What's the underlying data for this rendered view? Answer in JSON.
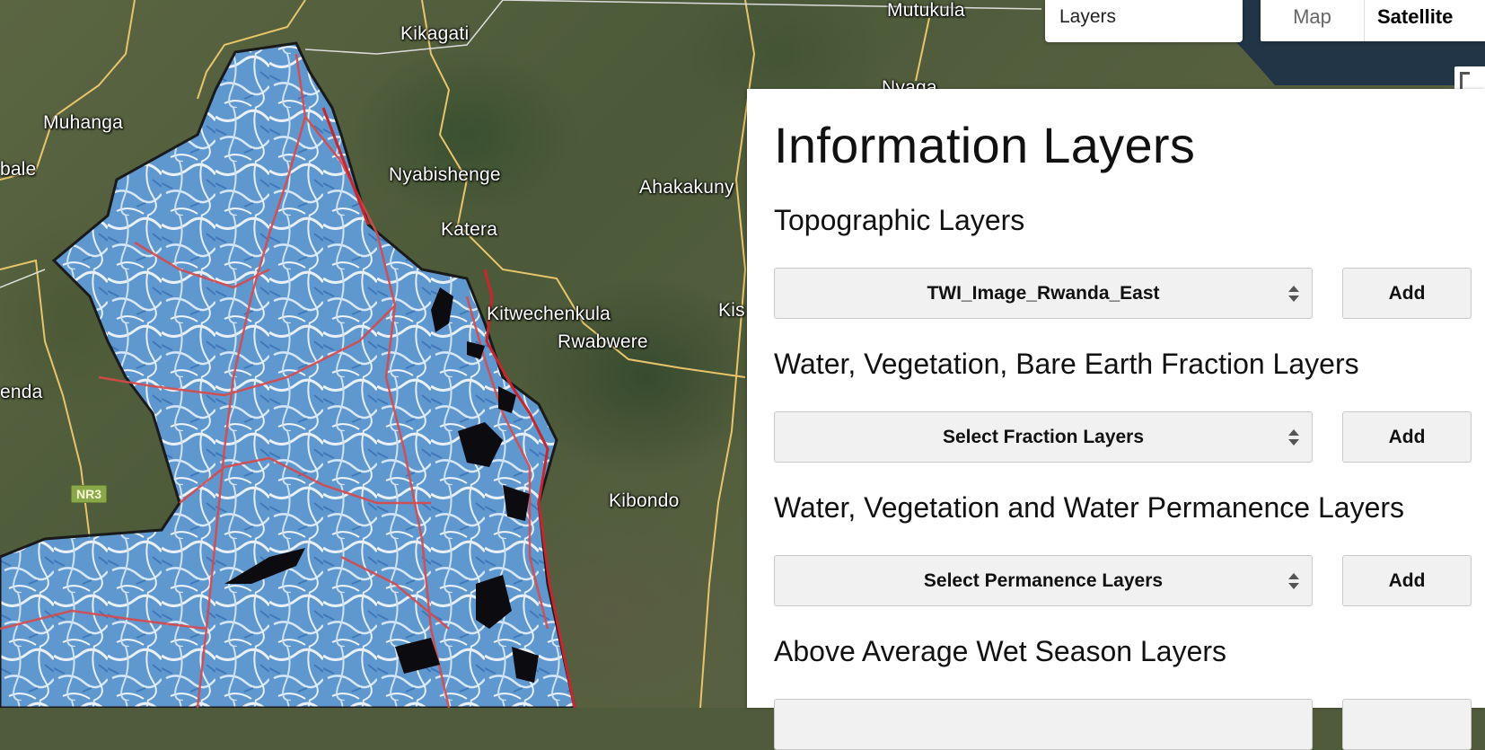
{
  "map": {
    "place_labels": [
      "Mutukula",
      "Kikagati",
      "Muhanga",
      "bale",
      "Nyabishenge",
      "Ahakakuny",
      "Katera",
      "Kitwechenkula",
      "Kis",
      "Rwabwere",
      "enda",
      "Kibondo",
      "Nyaga"
    ],
    "road_shield": "NR3"
  },
  "controls": {
    "layers_label": "Layers",
    "map_type": {
      "map": "Map",
      "satellite": "Satellite",
      "selected": "Satellite"
    }
  },
  "panel": {
    "title": "Information Layers",
    "sections": [
      {
        "title": "Topographic Layers",
        "select_value": "TWI_Image_Rwanda_East",
        "button": "Add"
      },
      {
        "title": "Water, Vegetation, Bare Earth Fraction Layers",
        "select_value": "Select Fraction Layers",
        "button": "Add"
      },
      {
        "title": "Water, Vegetation and Water Permanence Layers",
        "select_value": "Select Permanence Layers",
        "button": "Add"
      },
      {
        "title": "Above Average Wet Season Layers",
        "select_value": "",
        "button": ""
      }
    ]
  },
  "colors": {
    "overlay_blue": "#6fa3d6",
    "stream_red": "#d8494a",
    "panel_bg": "#ffffff",
    "button_bg": "#f1f1f1"
  }
}
